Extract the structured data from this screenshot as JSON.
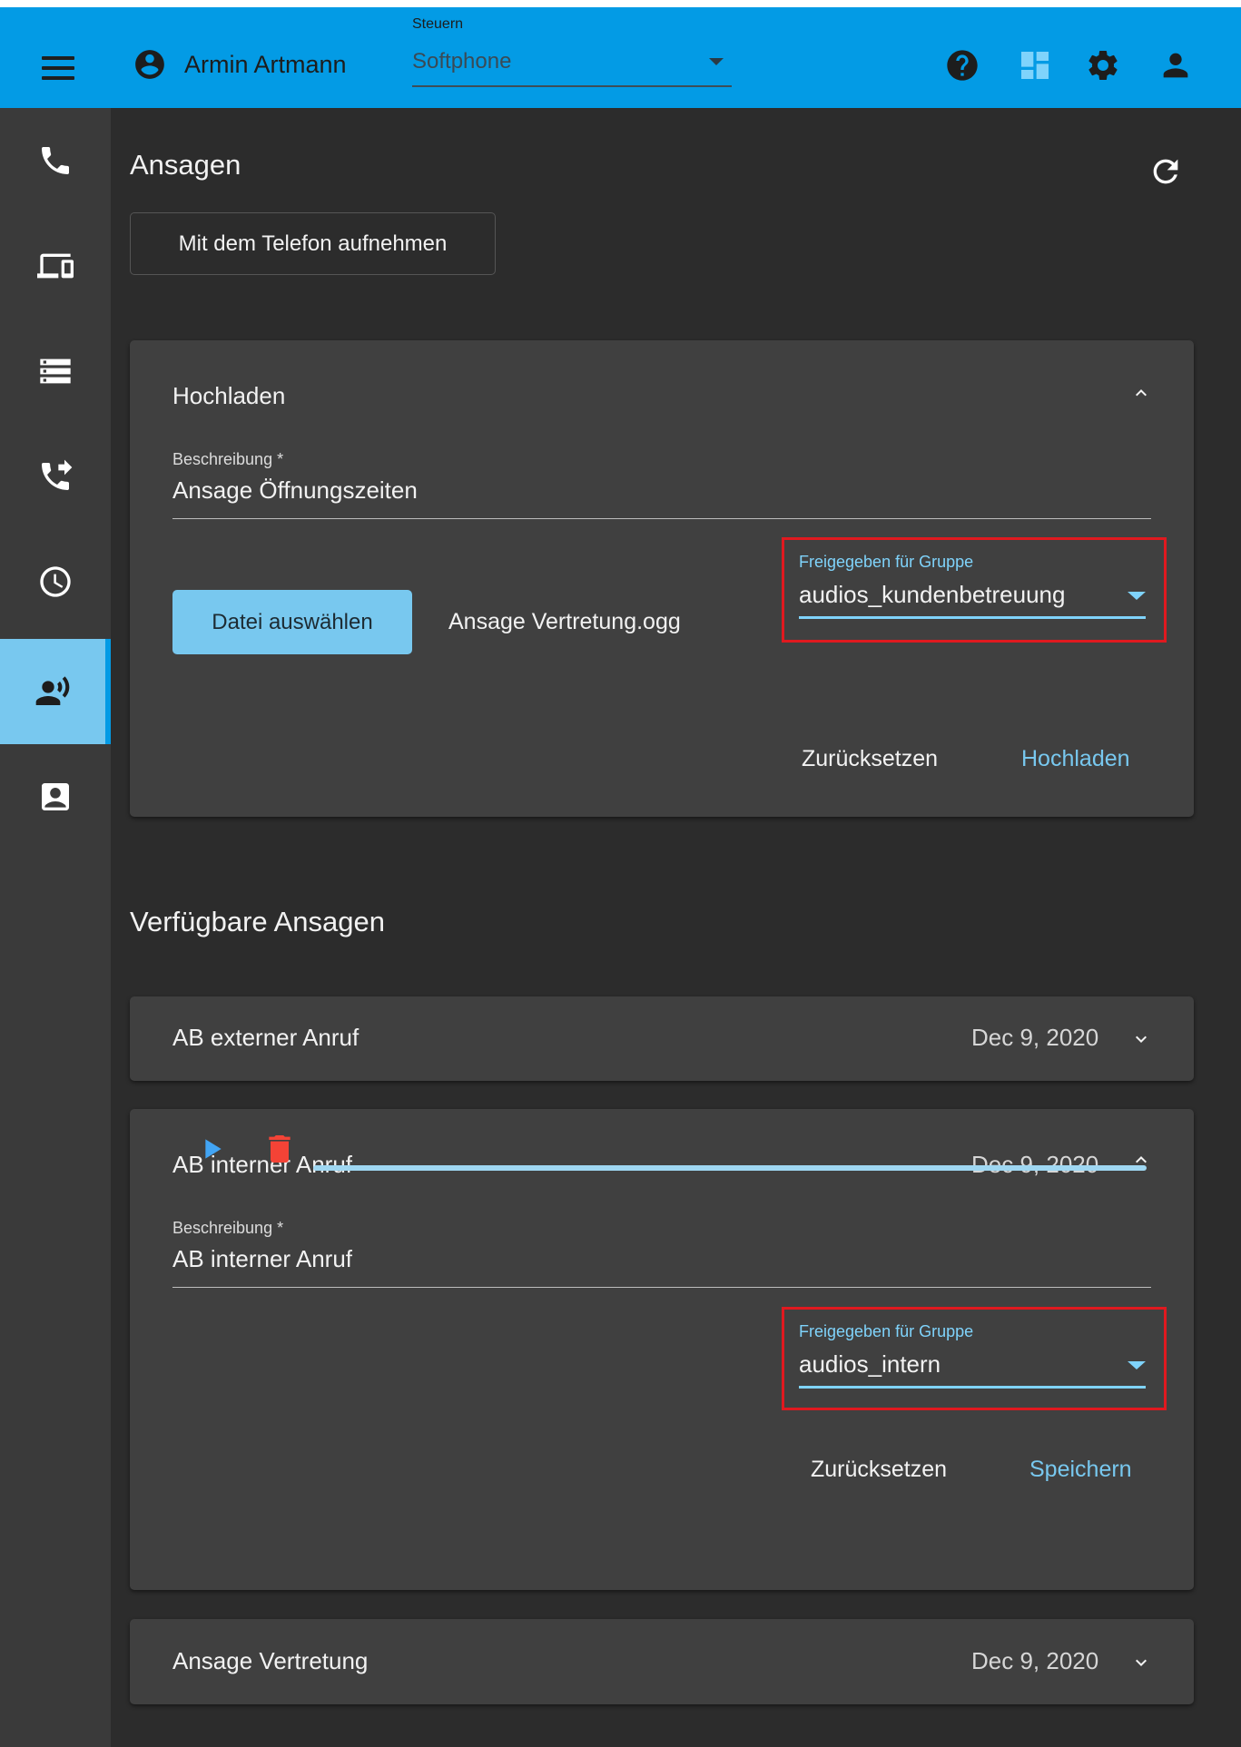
{
  "header": {
    "user_name": "Armin Artmann",
    "control_label": "Steuern",
    "control_value": "Softphone"
  },
  "page": {
    "title": "Ansagen",
    "record_button": "Mit dem Telefon aufnehmen"
  },
  "upload": {
    "title": "Hochladen",
    "description_label": "Beschreibung *",
    "description_value": "Ansage Öffnungszeiten",
    "file_button": "Datei auswählen",
    "file_name": "Ansage Vertretung.ogg",
    "group_label": "Freigegeben für Gruppe",
    "group_value": "audios_kundenbetreuung",
    "reset_label": "Zurücksetzen",
    "submit_label": "Hochladen"
  },
  "available": {
    "title": "Verfügbare Ansagen",
    "items": [
      {
        "title": "AB externer Anruf",
        "date": "Dec 9, 2020"
      },
      {
        "title": "AB interner Anruf",
        "date": "Dec 9, 2020",
        "description_label": "Beschreibung *",
        "description_value": "AB interner Anruf",
        "group_label": "Freigegeben für Gruppe",
        "group_value": "audios_intern",
        "reset_label": "Zurücksetzen",
        "save_label": "Speichern"
      },
      {
        "title": "Ansage Vertretung",
        "date": "Dec 9, 2020"
      }
    ]
  },
  "colors": {
    "accent": "#039be5",
    "accent_light": "#78c8ef",
    "highlight": "#e0191f",
    "delete": "#f44336"
  }
}
